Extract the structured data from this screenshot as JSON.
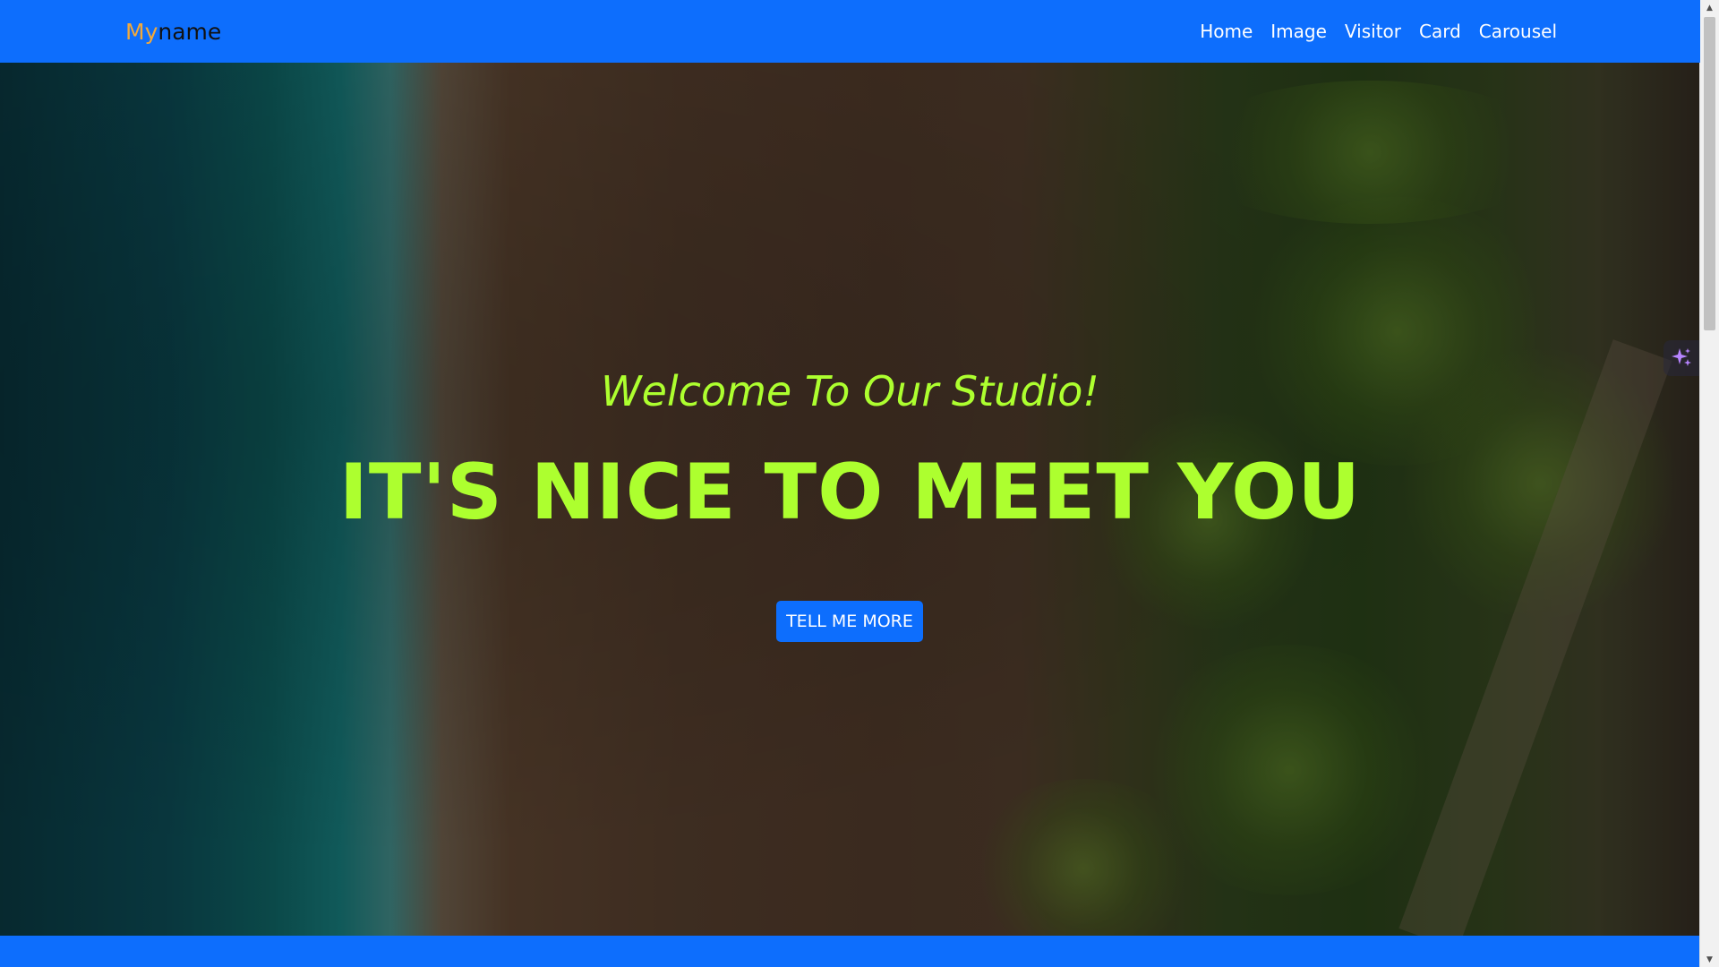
{
  "navbar": {
    "brand_part1": "My",
    "brand_part2": "name",
    "links": [
      {
        "label": "Home"
      },
      {
        "label": "Image"
      },
      {
        "label": "Visitor"
      },
      {
        "label": "Card"
      },
      {
        "label": "Carousel"
      }
    ]
  },
  "hero": {
    "subtitle": "Welcome To Our Studio!",
    "headline": "IT'S NICE TO MEET YOU",
    "cta_label": "TELL ME MORE"
  },
  "colors": {
    "nav_background": "#0d6efd",
    "brand_accent": "#f2a93b",
    "hero_text": "#adff2f",
    "button": "#0d6efd"
  },
  "icons": {
    "sparkle": "sparkle-icon",
    "scroll_up": "scroll-up-arrow-icon",
    "scroll_down": "scroll-down-arrow-icon"
  }
}
